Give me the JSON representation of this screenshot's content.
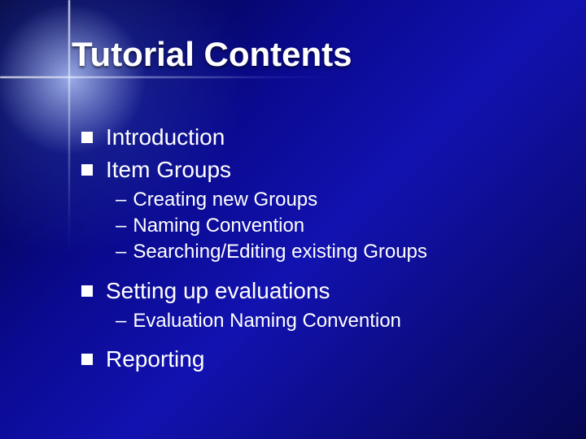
{
  "title": "Tutorial Contents",
  "items": {
    "i0": {
      "label": "Introduction"
    },
    "i1": {
      "label": "Item Groups"
    },
    "i1s": {
      "s0": "Creating new Groups",
      "s1": "Naming Convention",
      "s2": "Searching/Editing existing Groups"
    },
    "i2": {
      "label": "Setting up evaluations"
    },
    "i2s": {
      "s0": "Evaluation Naming Convention"
    },
    "i3": {
      "label": "Reporting"
    }
  },
  "dash": "–"
}
